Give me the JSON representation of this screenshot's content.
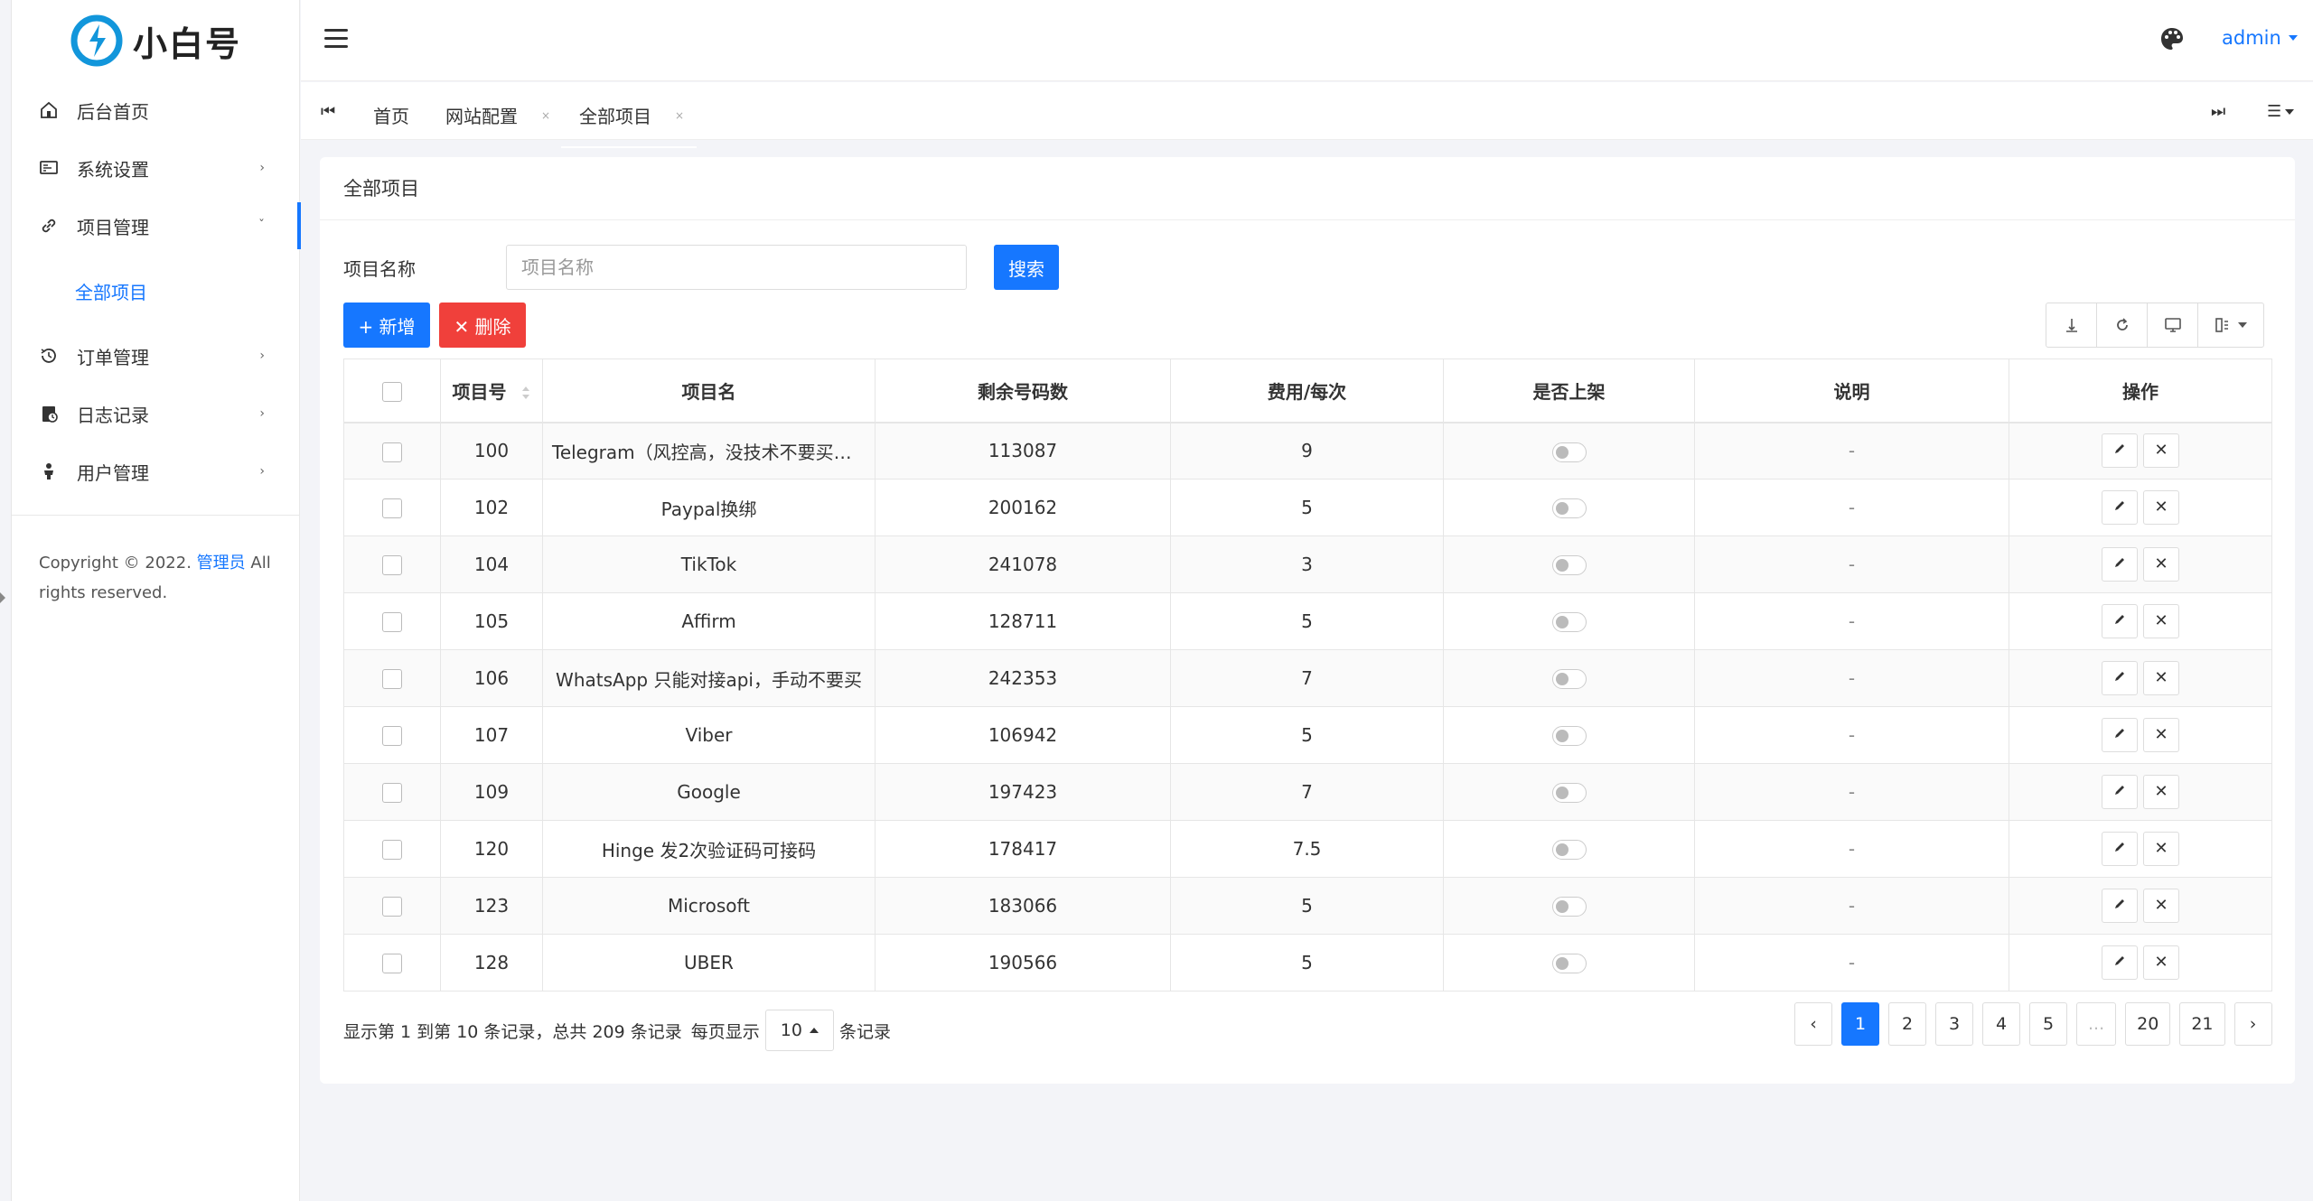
{
  "brand": {
    "name": "小白号"
  },
  "sidebar": {
    "items": [
      {
        "label": "后台首页",
        "icon": "dashboard-icon"
      },
      {
        "label": "系统设置",
        "icon": "settings-icon",
        "arrow": "›"
      },
      {
        "label": "项目管理",
        "icon": "link-icon",
        "arrow": "ˇ"
      },
      {
        "label": "订单管理",
        "icon": "history-icon",
        "arrow": "›"
      },
      {
        "label": "日志记录",
        "icon": "log-icon",
        "arrow": "›"
      },
      {
        "label": "用户管理",
        "icon": "user-icon",
        "arrow": "›"
      }
    ],
    "sub_item": "全部项目",
    "copyright_pre": "Copyright © 2022.",
    "copyright_link": "管理员",
    "copyright_post": "All rights reserved."
  },
  "header": {
    "user": "admin"
  },
  "tabs": [
    {
      "label": "首页",
      "closable": false
    },
    {
      "label": "网站配置",
      "closable": true
    },
    {
      "label": "全部项目",
      "closable": true
    }
  ],
  "page": {
    "title": "全部项目",
    "search_label": "项目名称",
    "search_placeholder": "项目名称",
    "search_button": "搜索",
    "add_button": "+ 新增",
    "delete_button": "✕ 删除"
  },
  "table": {
    "headers": [
      "项目号",
      "项目名",
      "剩余号码数",
      "费用/每次",
      "是否上架",
      "说明",
      "操作"
    ],
    "rows": [
      {
        "id": "100",
        "name": "Telegram（风控高，没技术不要买；系统不退款，请谨慎购买）",
        "remain": "113087",
        "fee": "9",
        "note": "-"
      },
      {
        "id": "102",
        "name": "Paypal换绑",
        "remain": "200162",
        "fee": "5",
        "note": "-"
      },
      {
        "id": "104",
        "name": "TikTok",
        "remain": "241078",
        "fee": "3",
        "note": "-"
      },
      {
        "id": "105",
        "name": "Affirm",
        "remain": "128711",
        "fee": "5",
        "note": "-"
      },
      {
        "id": "106",
        "name": "WhatsApp 只能对接api，手动不要买",
        "remain": "242353",
        "fee": "7",
        "note": "-"
      },
      {
        "id": "107",
        "name": "Viber",
        "remain": "106942",
        "fee": "5",
        "note": "-"
      },
      {
        "id": "109",
        "name": "Google",
        "remain": "197423",
        "fee": "7",
        "note": "-"
      },
      {
        "id": "120",
        "name": "Hinge 发2次验证码可接码",
        "remain": "178417",
        "fee": "7.5",
        "note": "-"
      },
      {
        "id": "123",
        "name": "Microsoft",
        "remain": "183066",
        "fee": "5",
        "note": "-"
      },
      {
        "id": "128",
        "name": "UBER",
        "remain": "190566",
        "fee": "5",
        "note": "-"
      }
    ]
  },
  "pagination": {
    "info": "显示第 1 到第 10 条记录，总共 209 条记录",
    "per_page_label": "每页显示",
    "per_page": "10",
    "per_page_suffix": "条记录",
    "prev": "‹",
    "next": "›",
    "pages": [
      "1",
      "2",
      "3",
      "4",
      "5",
      "...",
      "20",
      "21"
    ],
    "current": "1"
  },
  "colors": {
    "primary": "#1677ff",
    "danger": "#f0403b"
  }
}
